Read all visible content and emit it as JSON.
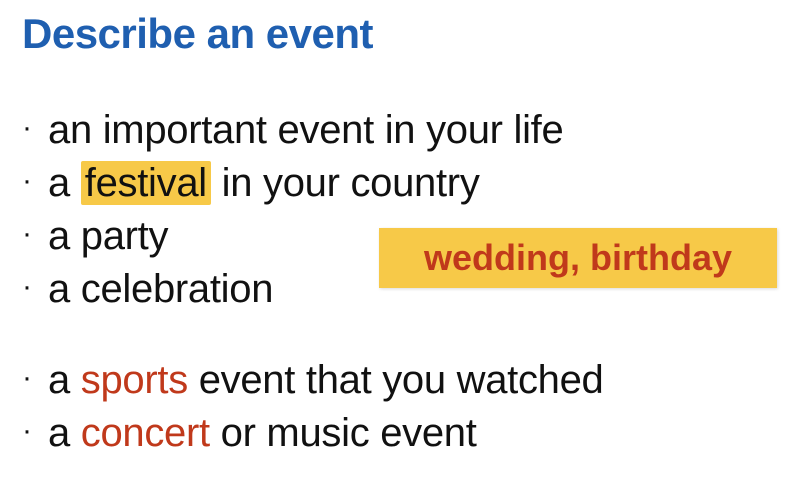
{
  "title": "Describe an event",
  "bullets": [
    {
      "bullet": "·",
      "parts": [
        {
          "text": "an important event in your life"
        }
      ]
    },
    {
      "bullet": "·",
      "parts": [
        {
          "text": "a "
        },
        {
          "text": "festival",
          "style": "highlight"
        },
        {
          "text": " in your country"
        }
      ]
    },
    {
      "bullet": "·",
      "parts": [
        {
          "text": "a party"
        }
      ]
    },
    {
      "bullet": "·",
      "parts": [
        {
          "text": "a celebration"
        }
      ]
    },
    {
      "bullet": "·",
      "parts": [
        {
          "text": "a "
        },
        {
          "text": "sports",
          "style": "red"
        },
        {
          "text": " event that you watched"
        }
      ]
    },
    {
      "bullet": "·",
      "parts": [
        {
          "text": "a "
        },
        {
          "text": "concert",
          "style": "red"
        },
        {
          "text": " or music event"
        }
      ]
    }
  ],
  "callout": "wedding, birthday",
  "colors": {
    "title": "#1f5fb0",
    "highlight": "#f7c948",
    "accent_red": "#c0391b",
    "text": "#111111"
  }
}
